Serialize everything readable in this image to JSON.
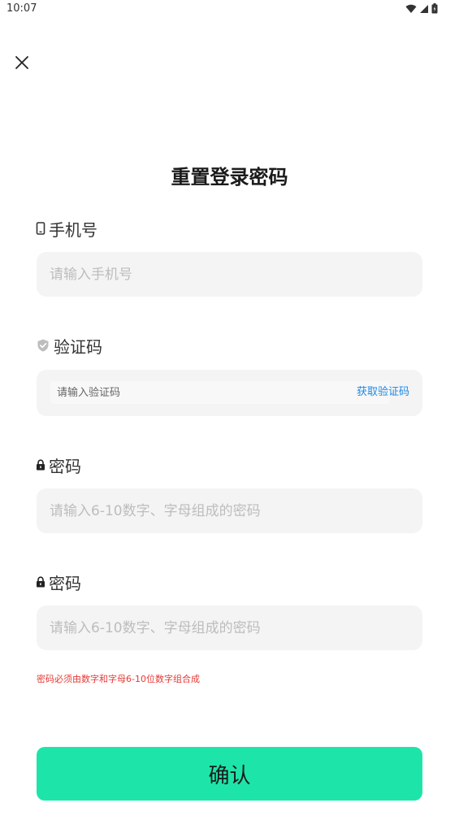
{
  "status_bar": {
    "time": "10:07",
    "icons": [
      "wifi-icon",
      "signal-icon",
      "battery-icon"
    ]
  },
  "header": {
    "close_icon": "close-icon"
  },
  "title": "重置登录密码",
  "fields": {
    "phone": {
      "label": "手机号",
      "icon": "phone-icon",
      "placeholder": "请输入手机号",
      "value": ""
    },
    "code": {
      "label": "验证码",
      "icon": "shield-check-icon",
      "placeholder": "请输入验证码",
      "value": "",
      "get_code_label": "获取验证码"
    },
    "password": {
      "label": "密码",
      "icon": "lock-icon",
      "placeholder": "请输入6-10数字、字母组成的密码",
      "value": ""
    },
    "password_confirm": {
      "label": "密码",
      "icon": "lock-icon",
      "placeholder": "请输入6-10数字、字母组成的密码",
      "value": ""
    }
  },
  "hint": "密码必须由数字和字母6-10位数字组合成",
  "confirm_label": "确认",
  "colors": {
    "accent": "#1de5a9",
    "link": "#1e88e5",
    "error": "#e53935",
    "input_bg": "#f4f4f4",
    "placeholder": "#bdbdbd"
  }
}
